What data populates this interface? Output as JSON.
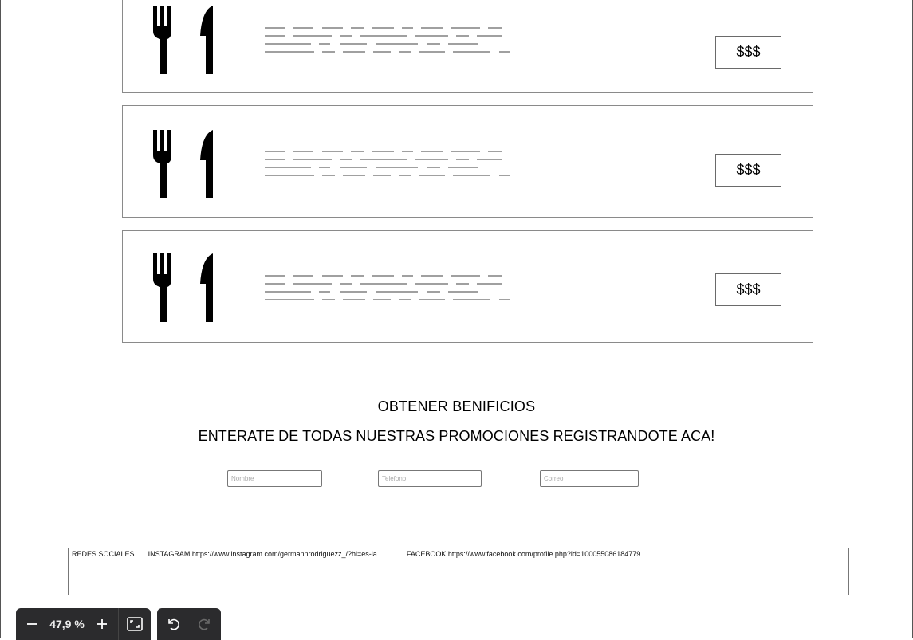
{
  "menu_items": [
    {
      "price": "$$$",
      "icon": "fork-knife-icon"
    },
    {
      "price": "$$$",
      "icon": "fork-knife-icon"
    },
    {
      "price": "$$$",
      "icon": "fork-knife-icon"
    }
  ],
  "promo": {
    "title": "OBTENER BENIFICIOS",
    "subtitle": "ENTERATE DE TODAS NUESTRAS PROMOCIONES REGISTRANDOTE ACA!"
  },
  "form": {
    "nombre_placeholder": "Nombre",
    "telefono_placeholder": "Telefono",
    "correo_placeholder": "Correo"
  },
  "social": {
    "label": "REDES SOCIALES",
    "instagram_label": "INSTAGRAM",
    "instagram_url": "https://www.instagram.com/germannrodriguezz_/?hl=es-la",
    "facebook_label": "FACEBOOK",
    "facebook_url": "https://www.facebook.com/profile.php?id=100055086184779"
  },
  "toolbar": {
    "zoom_level": "47,9 %",
    "icons": [
      "minus-icon",
      "plus-icon",
      "fit-screen-icon",
      "undo-icon",
      "redo-icon"
    ]
  },
  "colors": {
    "toolbar_bg": "#2b2b2d",
    "placeholder_lines": "#a0a0a0"
  }
}
